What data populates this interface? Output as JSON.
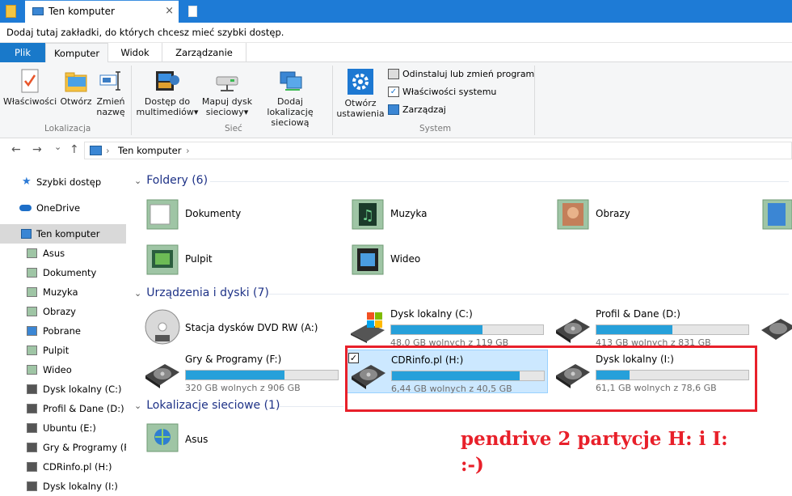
{
  "tab": {
    "title": "Ten komputer",
    "close": "×"
  },
  "bookmarks_bar": {
    "text": "Dodaj tutaj zakładki, do których chcesz mieć szybki dostęp."
  },
  "ribbon_tabs": {
    "plik": "Plik",
    "komputer": "Komputer",
    "widok": "Widok",
    "zarzadzanie": "Zarządzanie"
  },
  "ribbon": {
    "wlasciwosci": "Właściwości",
    "otworz": "Otwórz",
    "zmien_l1": "Zmień",
    "zmien_l2": "nazwę",
    "lokalizacja": "Lokalizacja",
    "dostep_l1": "Dostęp do",
    "dostep_l2": "multimediów",
    "mapuj_l1": "Mapuj dysk",
    "mapuj_l2": "sieciowy",
    "dodaj_l1": "Dodaj lokalizację",
    "dodaj_l2": "sieciową",
    "siec": "Sieć",
    "otworz_ust_l1": "Otwórz",
    "otworz_ust_l2": "ustawienia",
    "odinstaluj": "Odinstaluj lub zmień program",
    "wlasciwosci_systemu": "Właściwości systemu",
    "zarzadzaj": "Zarządzaj",
    "system": "System",
    "dropdown": "▾"
  },
  "address": {
    "back": "←",
    "forward": "→",
    "up": "↑",
    "recent": "⌄",
    "path": "Ten komputer",
    "sep": "›"
  },
  "nav": {
    "szybki": "Szybki dostęp",
    "onedrive": "OneDrive",
    "ten_komputer": "Ten komputer",
    "items": [
      "Asus",
      "Dokumenty",
      "Muzyka",
      "Obrazy",
      "Pobrane",
      "Pulpit",
      "Wideo",
      "Dysk lokalny (C:)",
      "Profil & Dane (D:)",
      "Ubuntu (E:)",
      "Gry & Programy (F:)",
      "CDRinfo.pl (H:)",
      "Dysk lokalny (I:)"
    ]
  },
  "sections": {
    "foldery": "Foldery (6)",
    "urzadzenia": "Urządzenia i dyski (7)",
    "lokalizacje": "Lokalizacje sieciowe (1)"
  },
  "folders": [
    "Dokumenty",
    "Muzyka",
    "Obrazy",
    "Pulpit",
    "Wideo"
  ],
  "drives": {
    "dvd": {
      "label": "Stacja dysków DVD RW (A:)"
    },
    "c": {
      "label": "Dysk lokalny (C:)",
      "free": "48,0 GB wolnych z 119 GB",
      "used_fraction": 0.6
    },
    "d": {
      "label": "Profil & Dane (D:)",
      "free": "413 GB wolnych z 831 GB",
      "used_fraction": 0.5
    },
    "f": {
      "label": "Gry & Programy (F:)",
      "free": "320 GB wolnych z 906 GB",
      "used_fraction": 0.65
    },
    "h": {
      "label": "CDRinfo.pl (H:)",
      "free": "6,44 GB wolnych z 40,5 GB",
      "used_fraction": 0.84
    },
    "i": {
      "label": "Dysk lokalny (I:)",
      "free": "61,1 GB wolnych z 78,6 GB",
      "used_fraction": 0.22
    }
  },
  "network": [
    "Asus"
  ],
  "annotation": {
    "line1": "pendrive 2 partycje H: i I:",
    "line2": ":-)",
    "color": "#e8202a"
  },
  "colors": {
    "accent": "#1e7bd6",
    "bar_fill": "#26a0da",
    "section_heading": "#1e3287",
    "selected": "#cce8ff"
  }
}
